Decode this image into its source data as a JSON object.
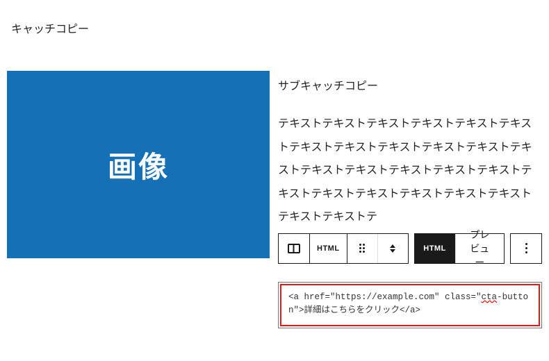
{
  "catchCopy": "キャッチコピー",
  "imagePlaceholderLabel": "画像",
  "subCatchCopy": "サブキャッチコピー",
  "bodyText": "テキストテキストテキストテキストテキストテキストテキストテキストテキストテキストテキストテキストテキストテキストテキストテキストテキストテキストテキストテキストテキストテキストテキストテキストテキストテ",
  "toolbar": {
    "blockTypeIcon": "columns-icon",
    "htmlPlain": "HTML",
    "htmlActive": "HTML",
    "preview": "プレビュー"
  },
  "htmlBlock": {
    "codePrefix": "<a href=\"https://example.com\" class=\"",
    "codeSquiggly": "cta",
    "codeSuffix": "-button\">詳細はこちらをクリック</a>"
  }
}
